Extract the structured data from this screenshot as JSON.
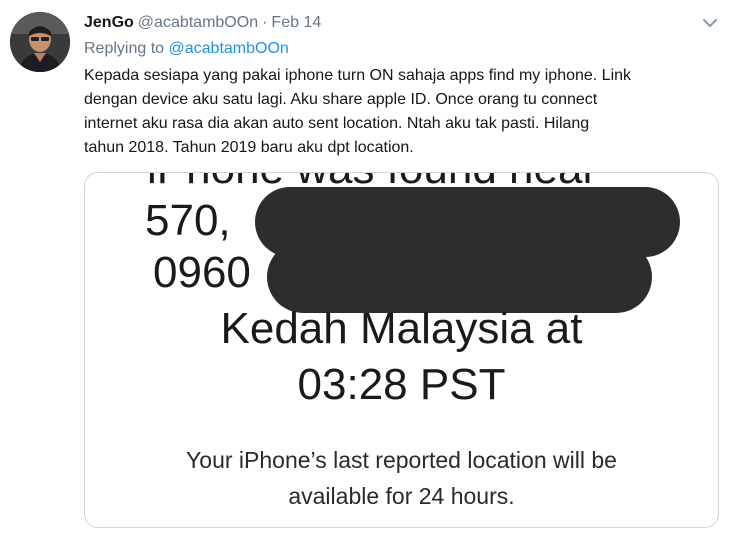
{
  "tweet": {
    "display_name": "JenGo",
    "handle": "@acabtambOOn",
    "separator": "·",
    "date": "Feb 14",
    "replying_prefix": "Replying to ",
    "replying_to": "@acabtambOOn",
    "body": "Kepada sesiapa yang pakai iphone turn ON sahaja apps find my iphone. Link\ndengan device aku satu lagi. Aku share apple ID. Once orang tu connect\ninternet aku rasa dia akan auto sent location. Ntah aku tak pasti. Hilang\ntahun 2018. Tahun 2019 baru aku dpt location."
  },
  "media": {
    "line_top_partial": "iPhone was found near",
    "line_570": "570,",
    "line_0960": "0960",
    "line_kedah": "Kedah Malaysia at",
    "line_time": "03:28 PST",
    "note_line1": "Your iPhone’s last reported location will be",
    "note_line2": "available for 24 hours."
  },
  "icons": {
    "menu": "chevron-down-icon",
    "avatar": "avatar-photo"
  },
  "colors": {
    "link": "#1b95e0",
    "muted": "#657786",
    "text": "#14171a",
    "redaction": "#2d2d2d"
  }
}
